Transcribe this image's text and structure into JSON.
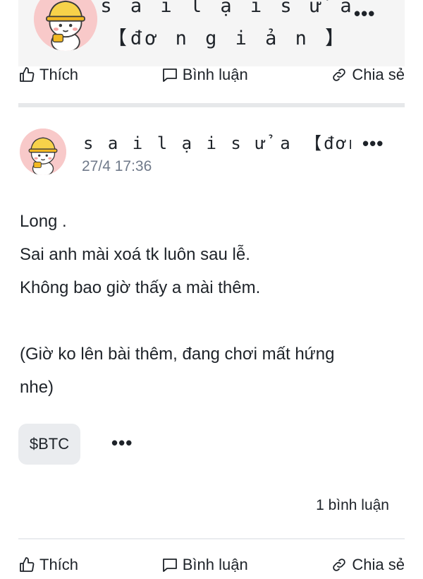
{
  "top_post": {
    "author": "s a i  l ạ i  s ử a 【đơ n g i ả n 】",
    "more_icon": "more-horizontal-icon"
  },
  "actions": {
    "like": "Thích",
    "comment": "Bình luận",
    "share": "Chia sẻ"
  },
  "post": {
    "author": "s a i  l ạ i  s ử a 【đơn g...",
    "time": "27/4 17:36",
    "body": [
      "Long .",
      "Sai anh mài xoá tk luôn sau lễ.",
      "Không bao giờ thấy a mài thêm.",
      "",
      "(Giờ ko lên bài thêm, đang chơi mất hứng",
      "nhe)"
    ],
    "tag": "$BTC",
    "comment_count": "1 bình luận"
  },
  "colors": {
    "avatar_bg": "#f8c9c9",
    "helmet": "#f7d24a",
    "card_bg": "#f5f5f5",
    "secondary_text": "#707a8a"
  }
}
